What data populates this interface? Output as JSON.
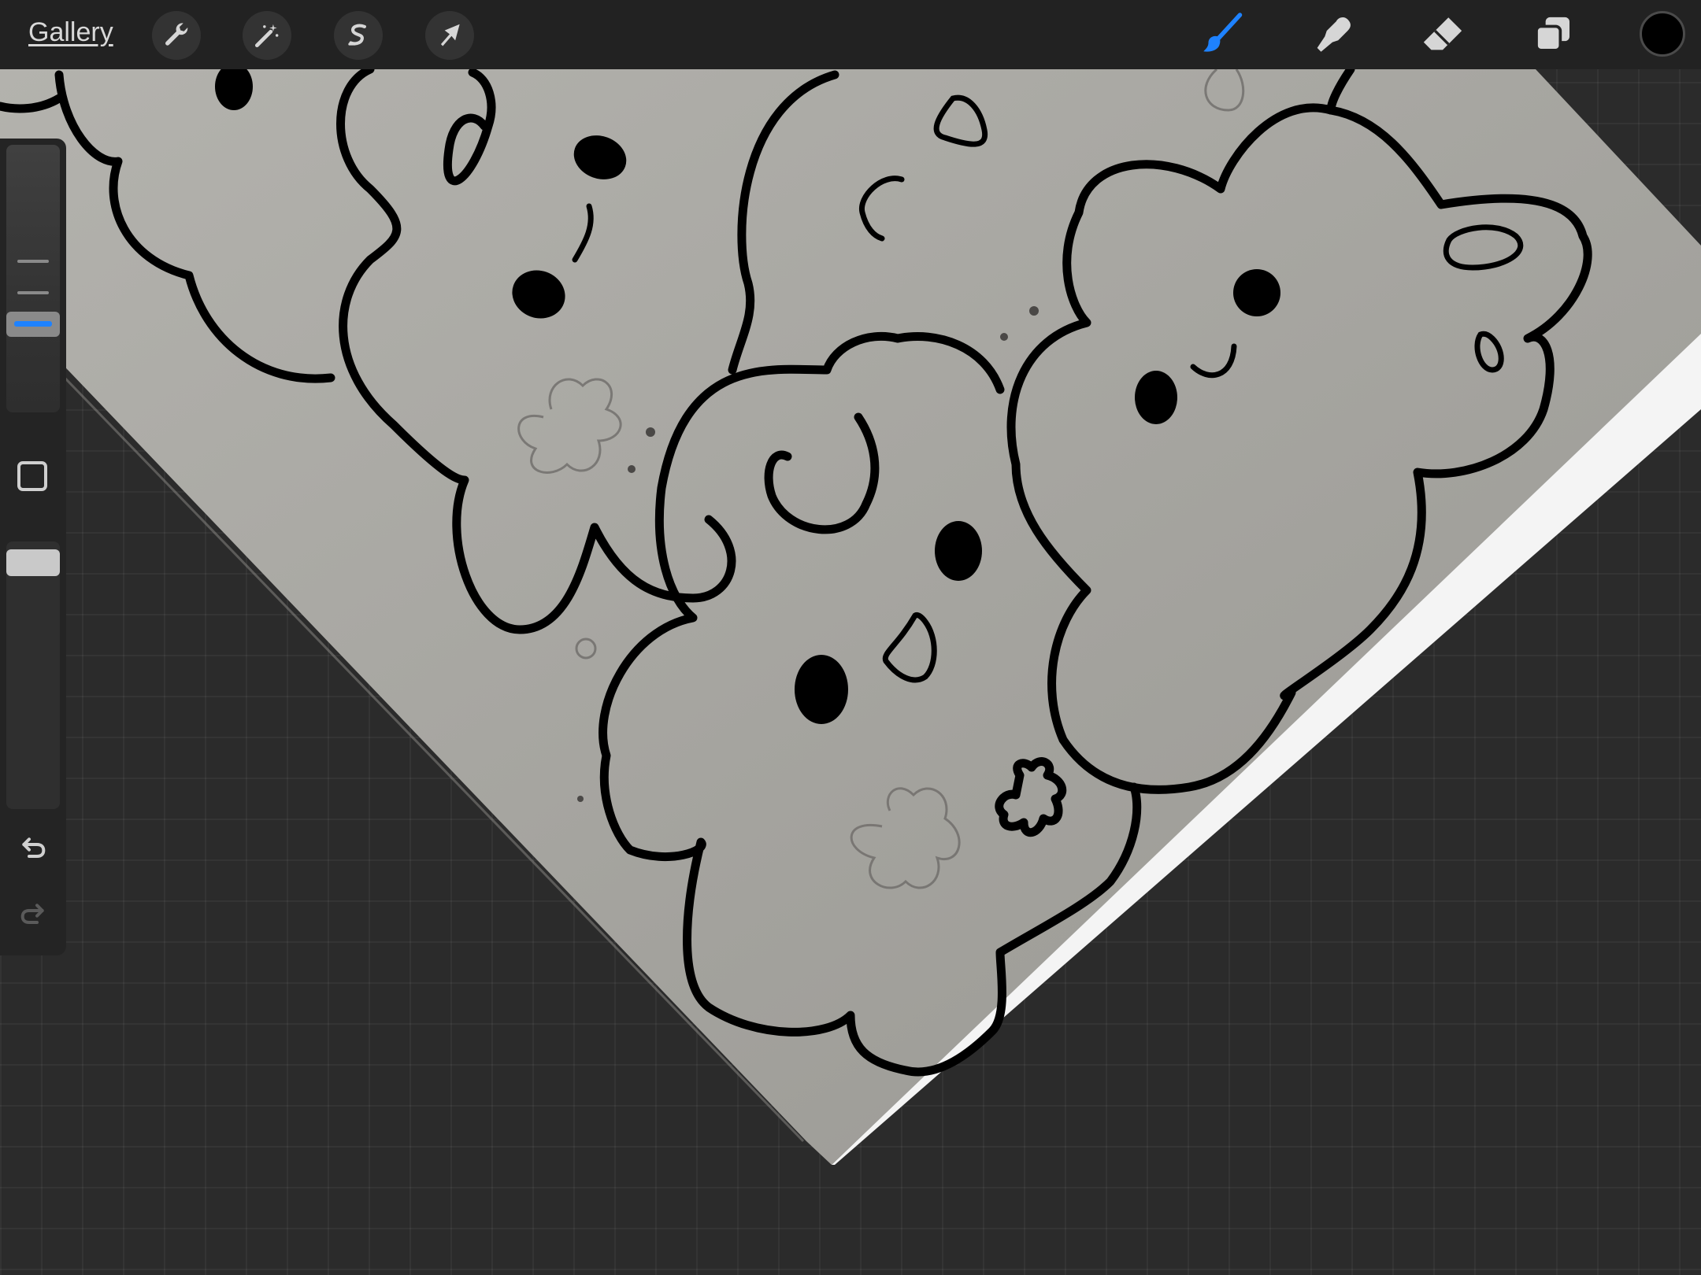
{
  "topbar": {
    "gallery_label": "Gallery",
    "left_tools": [
      {
        "name": "actions",
        "icon": "wrench-icon"
      },
      {
        "name": "adjustments",
        "icon": "magic-wand-icon"
      },
      {
        "name": "selection",
        "icon": "selection-s-icon"
      },
      {
        "name": "transform",
        "icon": "arrow-cursor-icon"
      }
    ],
    "right_tools": [
      {
        "name": "brush",
        "icon": "brush-icon",
        "active": true
      },
      {
        "name": "smudge",
        "icon": "smudge-finger-icon",
        "active": false
      },
      {
        "name": "eraser",
        "icon": "eraser-icon",
        "active": false
      },
      {
        "name": "layers",
        "icon": "layers-icon",
        "active": false
      }
    ],
    "current_color": "#000000"
  },
  "sidebar": {
    "brush_size_level": 0.36,
    "brush_opacity_level": 1.0,
    "modify_icon": "square-modify-icon",
    "undo_icon": "undo-arrow-icon",
    "redo_icon": "redo-arrow-icon"
  },
  "canvas": {
    "background": "#2b2b2b",
    "paper_color": "#a6a49f",
    "accent": "#1e82ff"
  }
}
